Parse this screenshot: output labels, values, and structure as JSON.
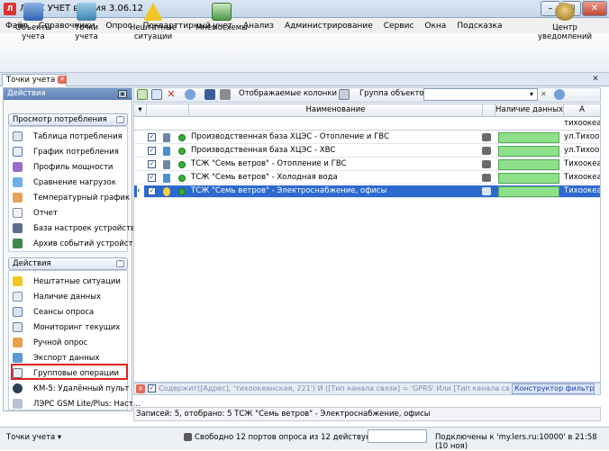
{
  "window": {
    "title": "ЛЭРС УЧЕТ версия 3.06.12",
    "app_icon": "lers-app-icon"
  },
  "menu": [
    "Файл",
    "Справочники",
    "Опрос",
    "Покварттирный учет",
    "Анализ",
    "Администрирование",
    "Сервис",
    "Окна",
    "Подсказка"
  ],
  "toolbar": {
    "objects": "Объекты учета",
    "points": "Точки учета",
    "emergency": "Нештатные ситуации",
    "mnemo": "Мнемосхемы",
    "notifications": "Центр уведомлений"
  },
  "doc_tab": {
    "label": "Точки учета"
  },
  "left_panel": {
    "header": "Действия",
    "group1": {
      "title": "Просмотр потребления",
      "items": [
        "Таблица потребления",
        "График потребления",
        "Профиль мощности",
        "Сравнение нагрузок",
        "Температурный график",
        "Отчет",
        "База настроек устройства",
        "Архив событий устройства"
      ]
    },
    "group2": {
      "title": "Действия",
      "items": [
        "Нештатные ситуации",
        "Наличие данных",
        "Сеансы опроса",
        "Мониторинг текущих",
        "Ручной опрос",
        "Экспорт данных",
        "Групповые операции",
        "КМ-5: Удалённый пульт",
        "ЛЭРС GSM Lite/Plus: Наст..."
      ]
    }
  },
  "grid_toolbar": {
    "columns_label": "Отображаемые колонки",
    "group_label": "Группа объектов:",
    "group_value": ""
  },
  "grid": {
    "col_name": "Наименование",
    "col_data": "Наличие данных",
    "col_address": "А",
    "filter_address": "тихоокеанская",
    "rows": [
      {
        "name": "Производственная база ХЦЭС - Отопление и ГВС",
        "address": "ул.Тихоокеанская",
        "selected": false
      },
      {
        "name": "Производственная база ХЦЭС - ХВС",
        "address": "ул.Тихоокеанская",
        "selected": false
      },
      {
        "name": "ТСЖ \"Семь ветров\" - Отопление и ГВС",
        "address": "Тихоокеанская",
        "selected": false
      },
      {
        "name": "ТСЖ \"Семь ветров\" - Холодная вода",
        "address": "Тихоокеанская",
        "selected": false
      },
      {
        "name": "ТСЖ \"Семь ветров\" - Электроснабжение, офисы",
        "address": "Тихоокеанская",
        "selected": true
      }
    ]
  },
  "filter": {
    "text": "Содержит([Адрес], 'тихоокеанская, 221') И ([Тип канала связи] = 'GPRS' Или [Тип канала связи] = 'Интернет')",
    "builder": "Конструктор фильтра..."
  },
  "records_status": "Записей: 5, отобрано: 5    ТСЖ \"Семь ветров\" - Электроснабжение, офисы",
  "status_bar": {
    "left": "Точки учета",
    "ports": "Свободно 12 портов опроса из 12 действующих",
    "connection": "Подключены к 'my.lers.ru:10000' в 21:58 (10 ноя)"
  }
}
